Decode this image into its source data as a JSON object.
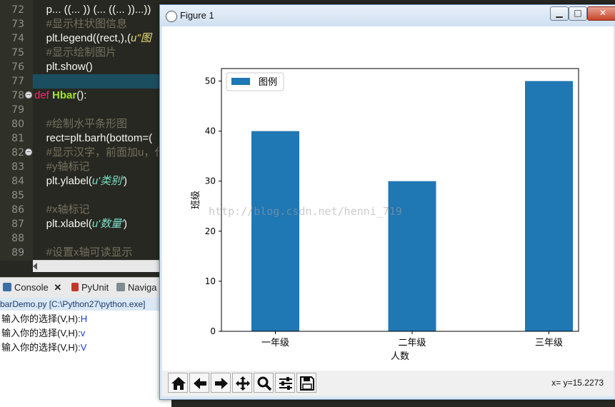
{
  "editor": {
    "lines": [
      {
        "n": "72",
        "html_parts": [
          {
            "cls": "",
            "t": "    p... ((... )) (... ((... ))...))"
          }
        ]
      },
      {
        "n": "73",
        "html_parts": [
          {
            "cls": "comment",
            "t": "    #显示柱状图信息"
          }
        ]
      },
      {
        "n": "74",
        "html_parts": [
          {
            "cls": "",
            "t": "    plt.legend((rect,),("
          },
          {
            "cls": "str",
            "t": "u\"图"
          }
        ]
      },
      {
        "n": "75",
        "html_parts": [
          {
            "cls": "comment",
            "t": "    #显示绘制图片"
          }
        ]
      },
      {
        "n": "76",
        "html_parts": [
          {
            "cls": "",
            "t": "    plt.show()"
          }
        ]
      },
      {
        "n": "77",
        "html_parts": [
          {
            "cls": "",
            "t": ""
          }
        ]
      },
      {
        "n": "78",
        "html_parts": [
          {
            "cls": "kw",
            "t": "def "
          },
          {
            "cls": "fn",
            "t": "Hbar"
          },
          {
            "cls": "",
            "t": "():"
          }
        ]
      },
      {
        "n": "79",
        "html_parts": [
          {
            "cls": "",
            "t": ""
          }
        ]
      },
      {
        "n": "80",
        "html_parts": [
          {
            "cls": "comment",
            "t": "    #绘制水平条形图"
          }
        ]
      },
      {
        "n": "81",
        "html_parts": [
          {
            "cls": "",
            "t": "    rect=plt.barh(bottom=("
          }
        ]
      },
      {
        "n": "82",
        "html_parts": [
          {
            "cls": "comment",
            "t": "    #显示汉字，前面加u，代"
          }
        ]
      },
      {
        "n": "83",
        "html_parts": [
          {
            "cls": "comment",
            "t": "    #y轴标记"
          }
        ]
      },
      {
        "n": "84",
        "html_parts": [
          {
            "cls": "",
            "t": "    plt.ylabel("
          },
          {
            "cls": "str2",
            "t": "u'类别'"
          },
          {
            "cls": "",
            "t": ")"
          }
        ]
      },
      {
        "n": "85",
        "html_parts": [
          {
            "cls": "",
            "t": ""
          }
        ]
      },
      {
        "n": "86",
        "html_parts": [
          {
            "cls": "comment",
            "t": "    #x轴标记"
          }
        ]
      },
      {
        "n": "87",
        "html_parts": [
          {
            "cls": "",
            "t": "    plt.xlabel("
          },
          {
            "cls": "str2",
            "t": "u'数量'"
          },
          {
            "cls": "",
            "t": ")"
          }
        ]
      },
      {
        "n": "88",
        "html_parts": [
          {
            "cls": "",
            "t": ""
          }
        ]
      },
      {
        "n": "89",
        "html_parts": [
          {
            "cls": "comment",
            "t": "    #设置x轴可读显示"
          }
        ]
      }
    ]
  },
  "console": {
    "tabs": [
      {
        "label": "Console",
        "close": "✕"
      },
      {
        "label": "PyUnit"
      },
      {
        "label": "Naviga"
      }
    ],
    "title": "barDemo.py [C:\\Python27\\python.exe]",
    "lines": [
      {
        "prompt": "输入你的选择(V,H):",
        "input": "H"
      },
      {
        "prompt": "输入你的选择(V,H):",
        "input": "v"
      },
      {
        "prompt": "输入你的选择(V,H):",
        "input": "V"
      }
    ]
  },
  "figure": {
    "title": "Figure 1",
    "coords": "x= y=15.2273",
    "watermark": "http://blog.csdn.net/henni_719",
    "bar_color": "#1f77b4"
  },
  "chart_data": {
    "type": "bar",
    "categories": [
      "一年级",
      "二年级",
      "三年级"
    ],
    "values": [
      40,
      30,
      50
    ],
    "xlabel": "人数",
    "ylabel": "班级",
    "ylim": [
      0,
      52.5
    ],
    "yticks": [
      0,
      10,
      20,
      30,
      40,
      50
    ],
    "legend": {
      "label": "图例",
      "position": "top-left"
    },
    "grid": false
  }
}
